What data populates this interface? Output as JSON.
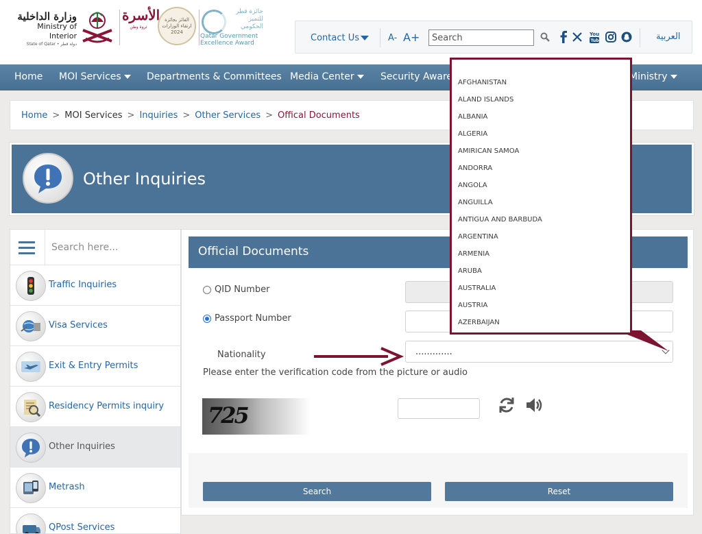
{
  "header": {
    "moi_logo_arabic": "وزارة الداخلية",
    "moi_logo_english": "Ministry of Interior",
    "moi_logo_sub": "State of Qatar • دولة قطر",
    "usra_logo_text": "الأسرة",
    "usra_logo_sub": "ثروة وطن",
    "award_badge_text": "الفائز بجائزة ارتقاء الوزارات 2024",
    "qgea_arabic": "جائزة قطر للتميز الحكومي",
    "qgea_english": "Qatar Government Excellence Award"
  },
  "utility_bar": {
    "contact_label": "Contact Us",
    "font_decrease": "A-",
    "font_increase": "A+",
    "search_placeholder": "Search",
    "arabic_link": "العربية",
    "icons": [
      "search-icon",
      "facebook-icon",
      "x-twitter-icon",
      "youtube-icon",
      "instagram-icon",
      "snapchat-icon"
    ]
  },
  "nav": {
    "items": [
      {
        "label": "Home",
        "has_dropdown": false
      },
      {
        "label": "MOI Services",
        "has_dropdown": true
      },
      {
        "label": "Departments & Committees",
        "has_dropdown": false
      },
      {
        "label": "Media Center",
        "has_dropdown": true
      },
      {
        "label": "Security Awareness",
        "has_dropdown": false
      },
      {
        "label": "Ministry",
        "has_dropdown": true
      }
    ]
  },
  "breadcrumb": {
    "items": [
      "Home",
      "MOI Services",
      "Inquiries",
      "Other Services",
      "Offical Documents"
    ]
  },
  "banner": {
    "title": "Other Inquiries"
  },
  "sidebar": {
    "search_placeholder": "Search here...",
    "items": [
      {
        "label": "Traffic Inquiries",
        "icon": "traffic-light-icon",
        "active": false
      },
      {
        "label": "Visa Services",
        "icon": "visa-services-icon",
        "active": false
      },
      {
        "label": "Exit & Entry Permits",
        "icon": "airplane-icon",
        "active": false
      },
      {
        "label": "Residency Permits inquiry",
        "icon": "residency-permit-icon",
        "active": false
      },
      {
        "label": "Other Inquiries",
        "icon": "info-bubble-icon",
        "active": true
      },
      {
        "label": "Metrash",
        "icon": "metrash-icon",
        "active": false
      },
      {
        "label": "QPost Services",
        "icon": "qpost-icon",
        "active": false
      }
    ]
  },
  "form": {
    "title": "Official Documents",
    "qid_label": "QID Number",
    "passport_label": "Passport Number",
    "selected_option": "passport",
    "nationality_label": "Nationality",
    "nationality_value": ".............",
    "verification_text": "Please enter the verification code from the picture or audio",
    "captcha_text": "725",
    "search_button": "Search",
    "reset_button": "Reset"
  },
  "nationality_dropdown": {
    "options": [
      "AFGHANISTAN",
      "ALAND ISLANDS",
      "ALBANIA",
      "ALGERIA",
      "AMIRICAN SAMOA",
      "ANDORRA",
      "ANGOLA",
      "ANGUILLA",
      "ANTIGUA AND BARBUDA",
      "ARGENTINA",
      "ARMENIA",
      "ARUBA",
      "AUSTRALIA",
      "AUSTRIA",
      "AZERBAIJAN"
    ]
  },
  "colors": {
    "brand_maroon": "#8a1538",
    "nav_blue": "#4b7397",
    "link_blue": "#2466a6",
    "annotation_maroon": "#7b1430"
  }
}
